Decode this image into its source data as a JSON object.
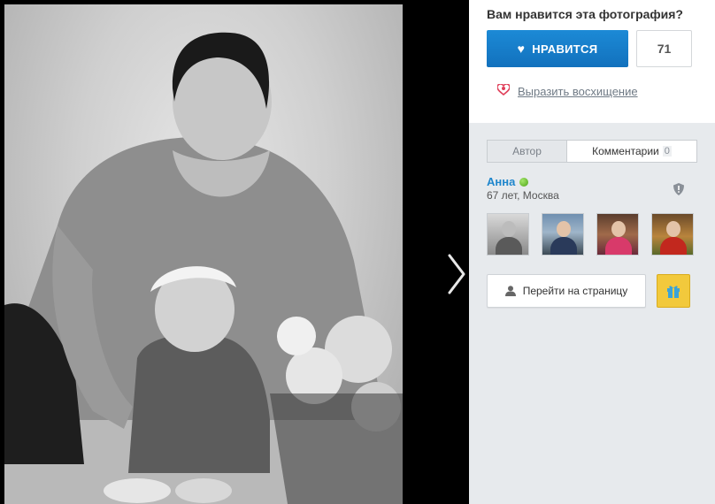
{
  "like_box": {
    "title": "Вам нравится эта фотография?",
    "like_label": "НРАВИТСЯ",
    "like_count": "71",
    "admire_label": "Выразить восхищение"
  },
  "tabs": {
    "author": "Автор",
    "comments": "Комментарии",
    "comments_count": "0"
  },
  "author": {
    "name": "Анна",
    "meta": "67 лет, Москва",
    "status": "online"
  },
  "actions": {
    "goto_page": "Перейти на страницу"
  },
  "icons": {
    "like": "heart-icon",
    "admire": "admire-heart-icon",
    "report": "shield-icon",
    "user": "user-icon",
    "gift": "gift-icon",
    "next": "chevron-right-icon"
  },
  "colors": {
    "accent": "#1a82cf",
    "author_link": "#1f86cc",
    "gift": "#f2c93c",
    "online": "#5cb82a"
  }
}
